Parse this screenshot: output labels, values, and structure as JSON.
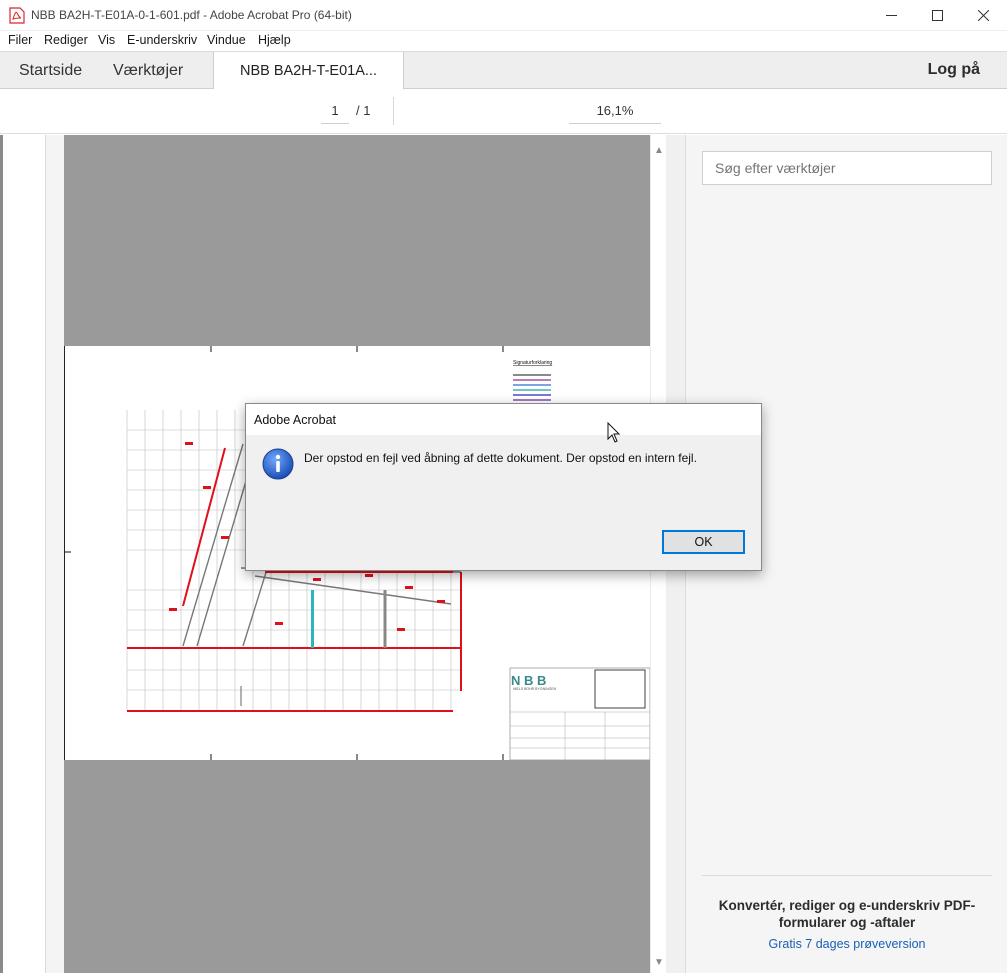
{
  "window": {
    "title": "NBB BA2H-T-E01A-0-1-601.pdf - Adobe Acrobat Pro (64-bit)"
  },
  "menu": {
    "items": [
      "Filer",
      "Rediger",
      "Vis",
      "E-underskriv",
      "Vindue",
      "Hjælp"
    ]
  },
  "tabs": {
    "home": "Startside",
    "tools": "Værktøjer",
    "document": "NBB BA2H-T-E01A...",
    "login": "Log på"
  },
  "toolbar": {
    "page_current": "1",
    "page_total": "/ 1",
    "zoom": "16,1%"
  },
  "right_panel": {
    "search_placeholder": "Søg efter værktøjer",
    "promo_title": "Konvertér, rediger og e-underskriv PDF-formularer og -aftaler",
    "promo_link": "Gratis 7 dages prøveversion"
  },
  "dialog": {
    "title": "Adobe Acrobat",
    "message": "Der opstod en fejl ved åbning af dette dokument. Der opstod en intern fejl.",
    "ok_label": "OK"
  },
  "drawing": {
    "company": "N B B",
    "company_sub": "NIELS BOHR BYGNINGEN"
  },
  "colors": {
    "accent": "#0078d7",
    "pdf_icon_red": "#d7282f",
    "link_blue": "#1a5fb4",
    "gray_bg": "#9a9a9a"
  }
}
